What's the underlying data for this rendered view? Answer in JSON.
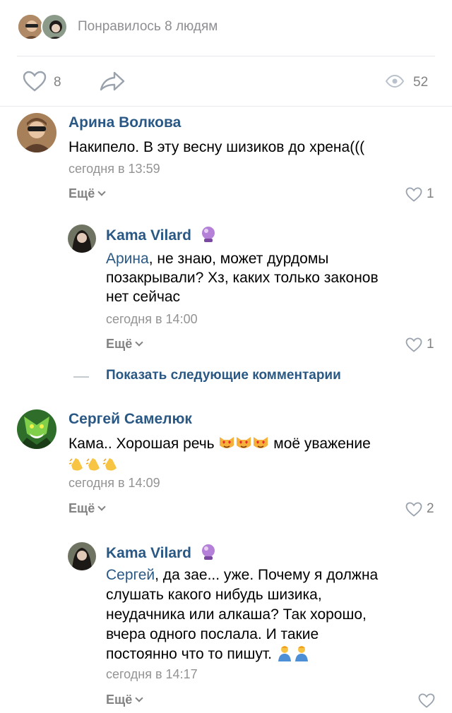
{
  "likes": {
    "text": "Понравилось 8 людям"
  },
  "actions": {
    "like_count": "8",
    "views_count": "52"
  },
  "show_more": "Показать следующие комментарии",
  "comments": [
    {
      "author": "Арина Волкова",
      "text": "Накипело. В эту весну шизиков до хрена(((",
      "time": "сегодня в 13:59",
      "more": "Ещё",
      "likes": "1"
    },
    {
      "author": "Kama Vilard",
      "mention": "Арина",
      "text_line1": ", не знаю, может дурдомы",
      "text_line2": "позакрывали? Хз, каких только законов",
      "text_line3": "нет сейчас",
      "time": "сегодня в 14:00",
      "more": "Ещё",
      "likes": "1"
    },
    {
      "author": "Сергей Самелюк",
      "text_start": "Кама.. Хорошая речь ",
      "text_end": " моё уважение",
      "time": "сегодня в 14:09",
      "more": "Ещё",
      "likes": "2"
    },
    {
      "author": "Kama Vilard",
      "mention": "Сергей",
      "text_line1": ", да зае... уже. Почему я должна",
      "text_line2": "слушать какого нибудь шизика,",
      "text_line3": "неудачника или алкаша? Так хорошо,",
      "text_line4": "вчера одного послала. И такие",
      "text_line5": "постоянно что то пишут. ",
      "time": "сегодня в 14:17",
      "more": "Ещё"
    }
  ],
  "colors": {
    "link": "#2a5885",
    "secondary": "#828282",
    "divider": "#e7e8ec"
  },
  "icons": [
    "heart-icon",
    "share-icon",
    "eye-icon",
    "crystal-ball-emoji",
    "heart-eyes-cat-emoji",
    "clapping-hands-emoji",
    "person-emoji",
    "chevron-down-icon"
  ]
}
